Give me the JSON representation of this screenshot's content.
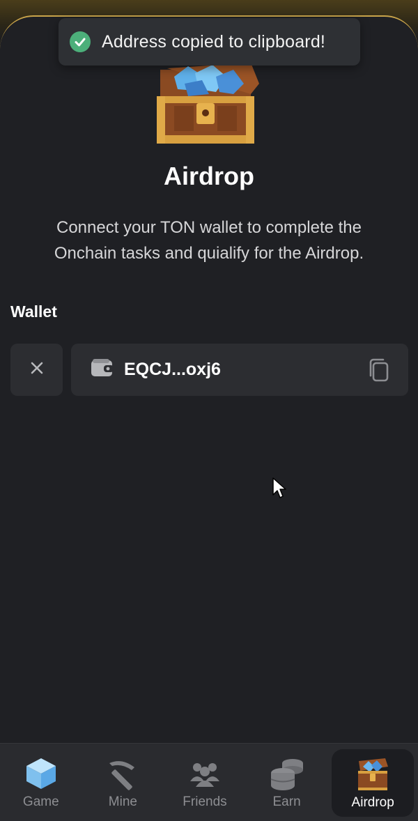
{
  "toast": {
    "message": "Address copied to clipboard!",
    "icon": "check-circle-icon",
    "color": "#4caf7a"
  },
  "page": {
    "title": "Airdrop",
    "description": "Connect your TON wallet to complete the Onchain tasks and quialify for the Airdrop.",
    "hero_icon": "treasure-chest-icon"
  },
  "wallet": {
    "label": "Wallet",
    "address": "EQCJ...oxj6",
    "disconnect_icon": "close-icon",
    "wallet_icon": "wallet-icon",
    "copy_icon": "copy-icon"
  },
  "nav": {
    "items": [
      {
        "label": "Game",
        "icon": "cube-icon",
        "active": false
      },
      {
        "label": "Mine",
        "icon": "pickaxe-icon",
        "active": false
      },
      {
        "label": "Friends",
        "icon": "friends-icon",
        "active": false
      },
      {
        "label": "Earn",
        "icon": "coins-icon",
        "active": false
      },
      {
        "label": "Airdrop",
        "icon": "treasure-chest-icon",
        "active": true
      }
    ]
  },
  "colors": {
    "accent_gold": "#c9a44a",
    "background": "#1f2024",
    "card": "#2c2d31"
  }
}
